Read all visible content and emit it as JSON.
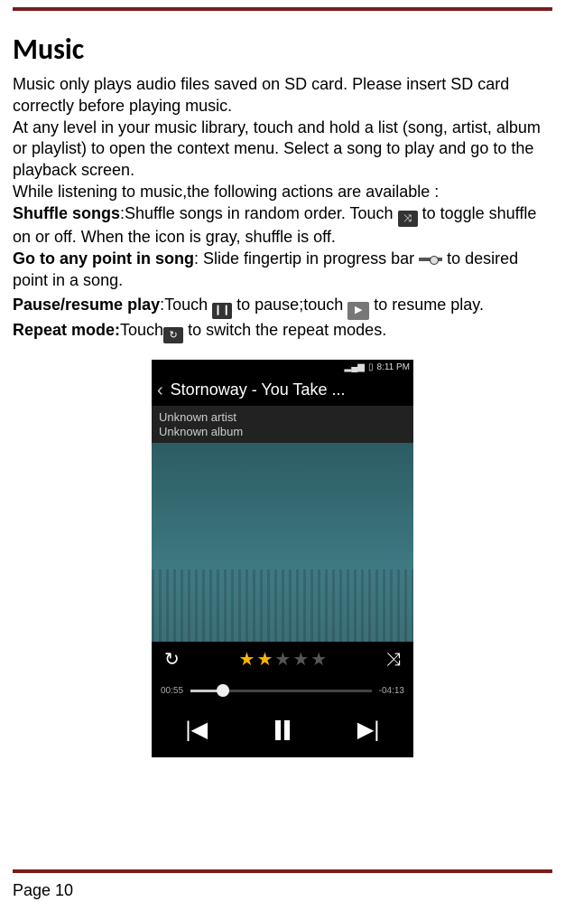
{
  "page_title": "Music",
  "paragraphs": {
    "p1": "Music only plays audio files saved on SD card. Please insert SD card correctly before playing music.",
    "p2": "At any level in your music library, touch and hold a list (song, artist, album or playlist) to open the context menu. Select a song to play and go to the playback screen.",
    "p3": "While listening to music,the following actions are available :",
    "shuffle_label": "Shuffle songs",
    "shuffle_text1": ":Shuffle songs in random order. Touch",
    "shuffle_text2": " to toggle shuffle on or off. When the icon is gray, shuffle is off.",
    "goto_label": "Go to any point in song",
    "goto_text1": ": Slide fingertip in progress bar",
    "goto_text2": " to desired point in a song.",
    "pause_label": "Pause/resume play",
    "pause_text1": ":Touch ",
    "pause_text2": " to pause;touch",
    "pause_text3": " to resume play.",
    "repeat_label": "Repeat mode:",
    "repeat_text1": "Touch",
    "repeat_text2": " to switch the repeat modes."
  },
  "phone": {
    "time": "8:11 PM",
    "signal": "▂▄▆",
    "battery": "▯",
    "back_chevron": "‹",
    "song_title": "Stornoway - You Take ...",
    "artist": "Unknown artist",
    "album": "Unknown album",
    "repeat_icon": "↻",
    "shuffle_icon": "⤨",
    "elapsed": "00:55",
    "remaining": "-04:13",
    "prev_icon": "|◀",
    "next_icon": "▶|",
    "rating": 2
  },
  "footer": "Page 10"
}
